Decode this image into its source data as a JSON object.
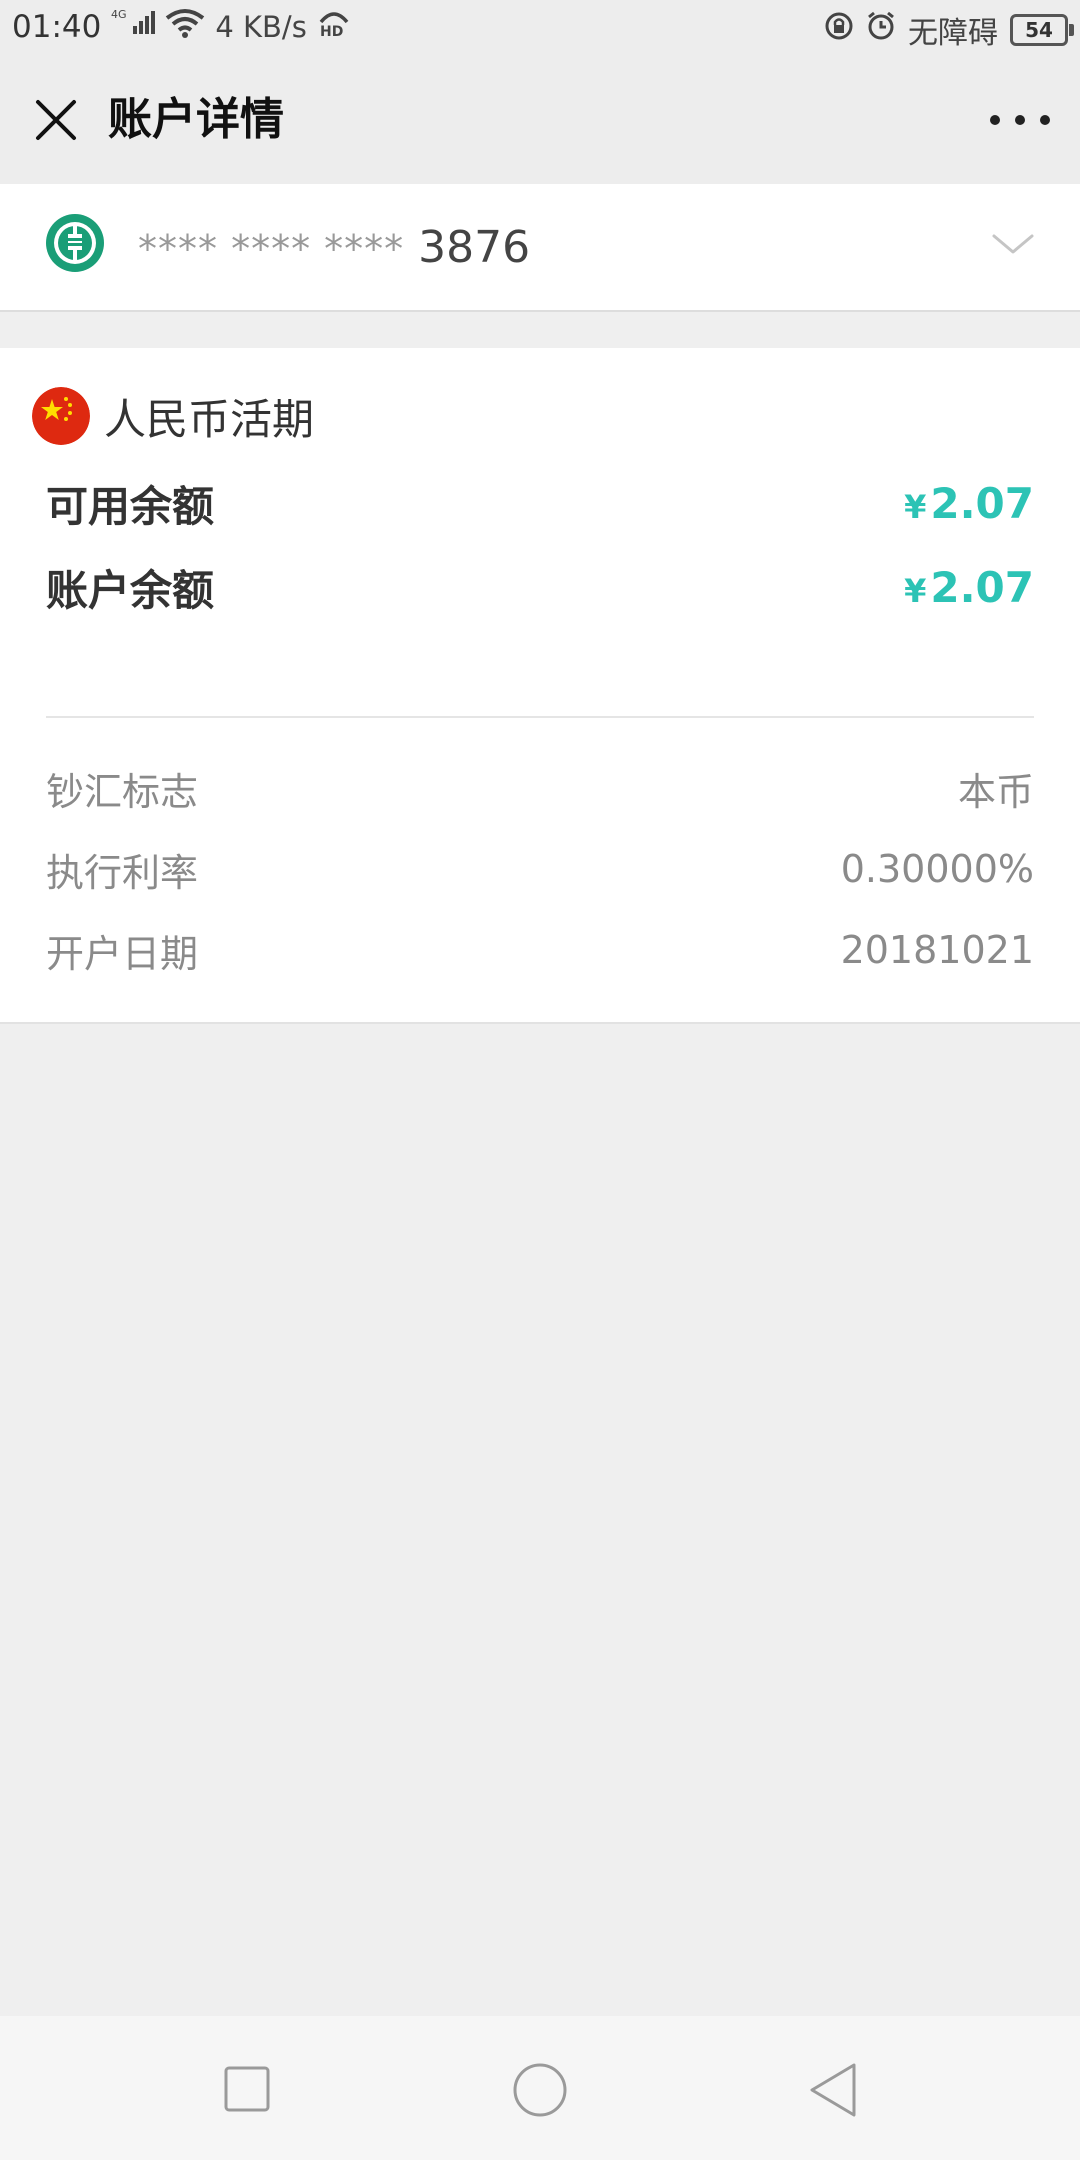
{
  "status_bar": {
    "time": "01:40",
    "network": "4G",
    "speed": "4 KB/s",
    "hd": "HD",
    "accessibility": "无障碍",
    "battery": "54"
  },
  "header": {
    "title": "账户详情"
  },
  "account": {
    "masked": "**** **** ****",
    "last4": "3876",
    "bank_icon": "abc-bank-logo"
  },
  "details": {
    "currency": "人民币活期",
    "balances": [
      {
        "label": "可用余额",
        "symbol": "¥",
        "amount": "2.07"
      },
      {
        "label": "账户余额",
        "symbol": "¥",
        "amount": "2.07"
      }
    ],
    "info": [
      {
        "label": "钞汇标志",
        "value": "本币"
      },
      {
        "label": "执行利率",
        "value": "0.30000%"
      },
      {
        "label": "开户日期",
        "value": "20181021"
      }
    ]
  },
  "colors": {
    "accent": "#2cc3b5",
    "bank_green": "#1a9e77",
    "flag_red": "#de2910",
    "flag_yellow": "#ffde00"
  },
  "icons": {
    "close": "close-icon",
    "more": "more-icon",
    "chevron": "chevron-down-icon",
    "nav_recent": "square-icon",
    "nav_home": "circle-icon",
    "nav_back": "triangle-back-icon"
  }
}
